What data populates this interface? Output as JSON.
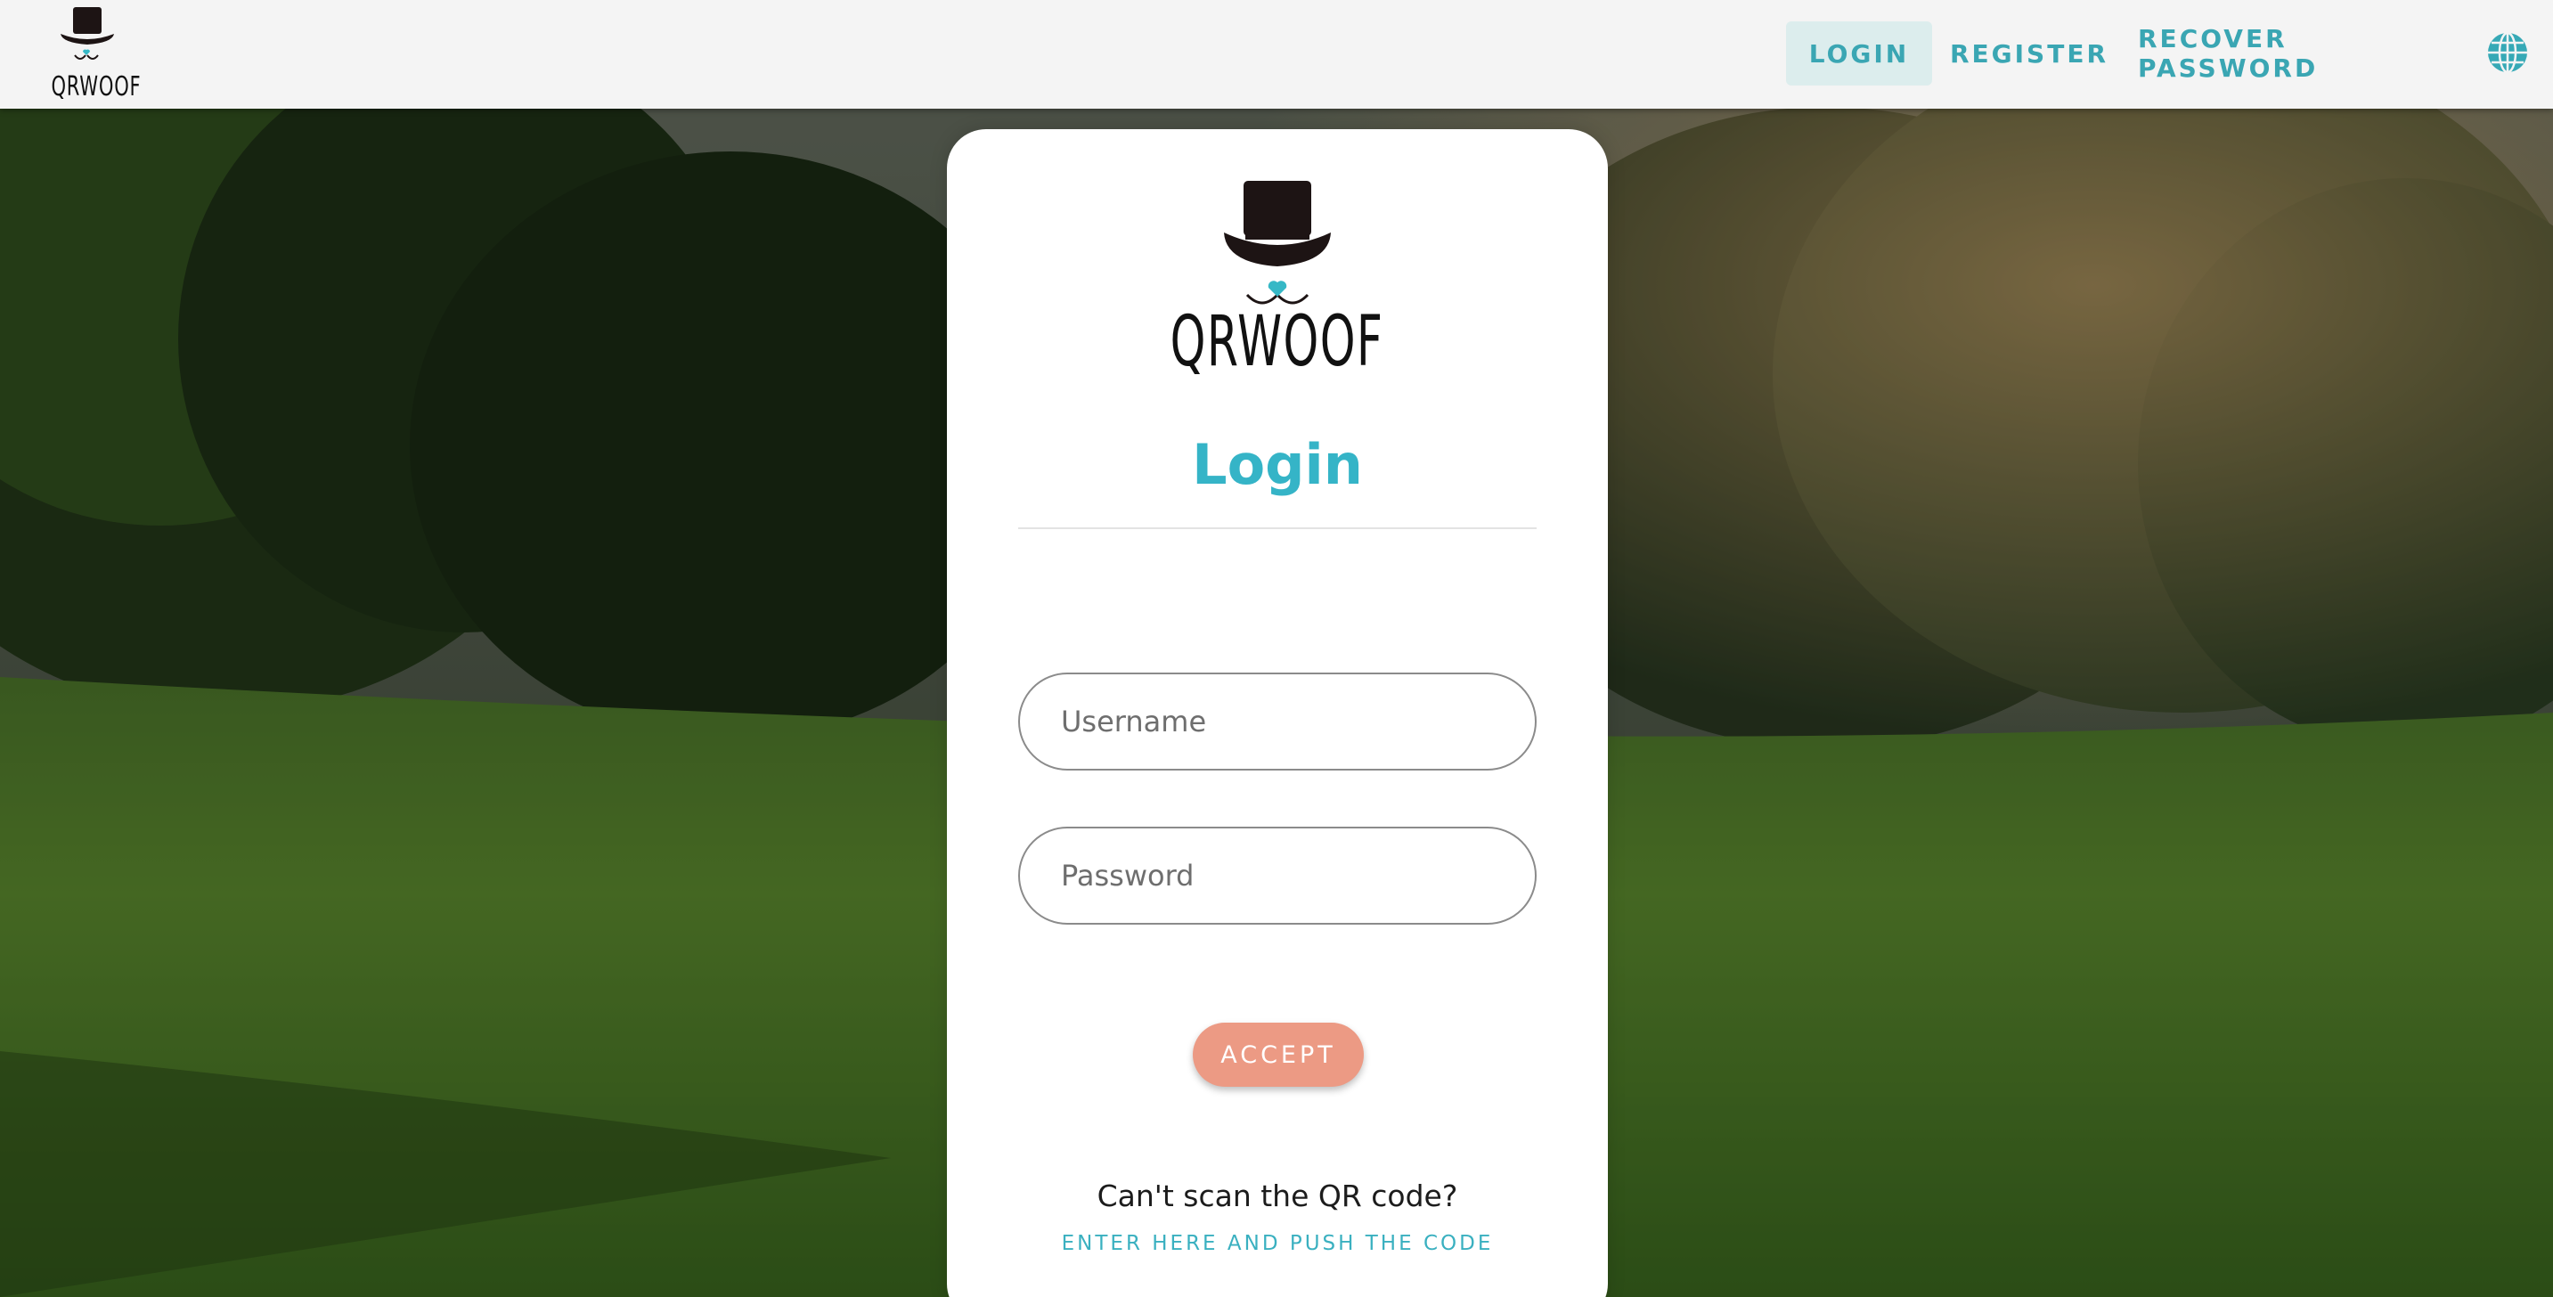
{
  "brand": {
    "name": "QRWOOF",
    "accent_color": "#35b4c7",
    "heart_color": "#36b8c6"
  },
  "nav": {
    "items": [
      {
        "label": "LOGIN",
        "active": true
      },
      {
        "label": "REGISTER",
        "active": false
      },
      {
        "label": "RECOVER PASSWORD",
        "active": false
      }
    ],
    "language_icon": "globe-icon"
  },
  "login": {
    "title": "Login",
    "username_placeholder": "Username",
    "password_placeholder": "Password",
    "accept_label": "ACCEPT",
    "accept_color": "#ec9a84",
    "qr_question": "Can't scan the QR code?",
    "qr_link": "ENTER HERE AND PUSH THE CODE"
  },
  "background": {
    "icon": "park-photo"
  }
}
